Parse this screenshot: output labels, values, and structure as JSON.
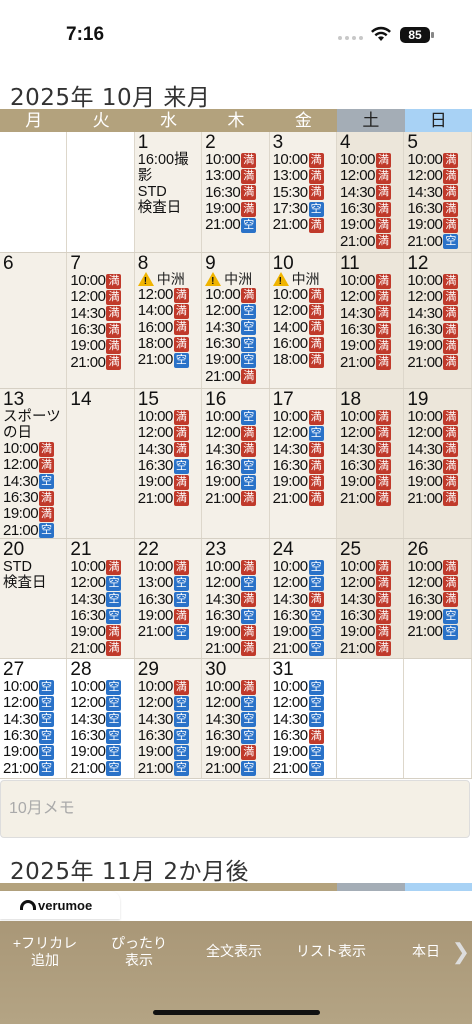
{
  "status": {
    "time": "7:16",
    "battery": "85"
  },
  "month1": {
    "title": "2025年 10月 来月"
  },
  "month2": {
    "title": "2025年 11月 2か月後"
  },
  "weekdays": [
    "月",
    "火",
    "水",
    "木",
    "金",
    "土",
    "日"
  ],
  "badges": {
    "full": "満",
    "open": "空"
  },
  "memo": {
    "placeholder": "10月メモ"
  },
  "ad": {
    "brand": "verumoe"
  },
  "toolbar": {
    "add_label": "+フリカレ\n追加",
    "fit_label": "ぴったり\n表示",
    "fulltext_label": "全文表示",
    "list_label": "リスト表示",
    "today_label": "本日",
    "more_arrow": "❯"
  },
  "weeks": [
    [
      {
        "empty": true
      },
      {
        "empty": true
      },
      {
        "day": "1",
        "note": "16:00撮影\nSTD\n検査日",
        "slots": []
      },
      {
        "day": "2",
        "slots": [
          [
            "10:00",
            "満"
          ],
          [
            "13:00",
            "満"
          ],
          [
            "16:30",
            "満"
          ],
          [
            "19:00",
            "満"
          ],
          [
            "21:00",
            "空"
          ]
        ]
      },
      {
        "day": "3",
        "slots": [
          [
            "10:00",
            "満"
          ],
          [
            "13:00",
            "満"
          ],
          [
            "15:30",
            "満"
          ],
          [
            "17:30",
            "空"
          ],
          [
            "21:00",
            "満"
          ]
        ]
      },
      {
        "day": "4",
        "weekend": true,
        "slots": [
          [
            "10:00",
            "満"
          ],
          [
            "12:00",
            "満"
          ],
          [
            "14:30",
            "満"
          ],
          [
            "16:30",
            "満"
          ],
          [
            "19:00",
            "満"
          ],
          [
            "21:00",
            "満"
          ]
        ]
      },
      {
        "day": "5",
        "weekend": true,
        "slots": [
          [
            "10:00",
            "満"
          ],
          [
            "12:00",
            "満"
          ],
          [
            "14:30",
            "満"
          ],
          [
            "16:30",
            "満"
          ],
          [
            "19:00",
            "満"
          ],
          [
            "21:00",
            "空"
          ]
        ]
      }
    ],
    [
      {
        "day": "6",
        "muted": true,
        "slots": []
      },
      {
        "day": "7",
        "slots": [
          [
            "10:00",
            "満"
          ],
          [
            "12:00",
            "満"
          ],
          [
            "14:30",
            "満"
          ],
          [
            "16:30",
            "満"
          ],
          [
            "19:00",
            "満"
          ],
          [
            "21:00",
            "満"
          ]
        ]
      },
      {
        "day": "8",
        "warn": "中洲",
        "slots": [
          [
            "12:00",
            "満"
          ],
          [
            "14:00",
            "満"
          ],
          [
            "16:00",
            "満"
          ],
          [
            "18:00",
            "満"
          ],
          [
            "21:00",
            "空"
          ]
        ]
      },
      {
        "day": "9",
        "warn": "中洲",
        "slots": [
          [
            "10:00",
            "満"
          ],
          [
            "12:00",
            "空"
          ],
          [
            "14:30",
            "空"
          ],
          [
            "16:30",
            "空"
          ],
          [
            "19:00",
            "空"
          ],
          [
            "21:00",
            "満"
          ]
        ]
      },
      {
        "day": "10",
        "warn": "中洲",
        "slots": [
          [
            "10:00",
            "満"
          ],
          [
            "12:00",
            "満"
          ],
          [
            "14:00",
            "満"
          ],
          [
            "16:00",
            "満"
          ],
          [
            "18:00",
            "満"
          ]
        ]
      },
      {
        "day": "11",
        "weekend": true,
        "slots": [
          [
            "10:00",
            "満"
          ],
          [
            "12:00",
            "満"
          ],
          [
            "14:30",
            "満"
          ],
          [
            "16:30",
            "満"
          ],
          [
            "19:00",
            "満"
          ],
          [
            "21:00",
            "満"
          ]
        ]
      },
      {
        "day": "12",
        "weekend": true,
        "slots": [
          [
            "10:00",
            "満"
          ],
          [
            "12:00",
            "満"
          ],
          [
            "14:30",
            "満"
          ],
          [
            "16:30",
            "満"
          ],
          [
            "19:00",
            "満"
          ],
          [
            "21:00",
            "満"
          ]
        ]
      }
    ],
    [
      {
        "day": "13",
        "note": "スポーツ\nの日",
        "slots": [
          [
            "10:00",
            "満"
          ],
          [
            "12:00",
            "満"
          ],
          [
            "14:30",
            "空"
          ],
          [
            "16:30",
            "満"
          ],
          [
            "19:00",
            "満"
          ],
          [
            "21:00",
            "空"
          ]
        ]
      },
      {
        "day": "14",
        "muted": true,
        "slots": []
      },
      {
        "day": "15",
        "slots": [
          [
            "10:00",
            "満"
          ],
          [
            "12:00",
            "満"
          ],
          [
            "14:30",
            "満"
          ],
          [
            "16:30",
            "空"
          ],
          [
            "19:00",
            "満"
          ],
          [
            "21:00",
            "満"
          ]
        ]
      },
      {
        "day": "16",
        "slots": [
          [
            "10:00",
            "空"
          ],
          [
            "12:00",
            "満"
          ],
          [
            "14:30",
            "満"
          ],
          [
            "16:30",
            "空"
          ],
          [
            "19:00",
            "空"
          ],
          [
            "21:00",
            "満"
          ]
        ]
      },
      {
        "day": "17",
        "slots": [
          [
            "10:00",
            "満"
          ],
          [
            "12:00",
            "空"
          ],
          [
            "14:30",
            "満"
          ],
          [
            "16:30",
            "満"
          ],
          [
            "19:00",
            "満"
          ],
          [
            "21:00",
            "満"
          ]
        ]
      },
      {
        "day": "18",
        "weekend": true,
        "slots": [
          [
            "10:00",
            "満"
          ],
          [
            "12:00",
            "満"
          ],
          [
            "14:30",
            "満"
          ],
          [
            "16:30",
            "満"
          ],
          [
            "19:00",
            "満"
          ],
          [
            "21:00",
            "満"
          ]
        ]
      },
      {
        "day": "19",
        "weekend": true,
        "slots": [
          [
            "10:00",
            "満"
          ],
          [
            "12:00",
            "満"
          ],
          [
            "14:30",
            "満"
          ],
          [
            "16:30",
            "満"
          ],
          [
            "19:00",
            "満"
          ],
          [
            "21:00",
            "満"
          ]
        ]
      }
    ],
    [
      {
        "day": "20",
        "note": "STD\n検査日",
        "slots": []
      },
      {
        "day": "21",
        "slots": [
          [
            "10:00",
            "満"
          ],
          [
            "12:00",
            "空"
          ],
          [
            "14:30",
            "空"
          ],
          [
            "16:30",
            "空"
          ],
          [
            "19:00",
            "満"
          ],
          [
            "21:00",
            "満"
          ]
        ]
      },
      {
        "day": "22",
        "slots": [
          [
            "10:00",
            "満"
          ],
          [
            "13:00",
            "空"
          ],
          [
            "16:30",
            "空"
          ],
          [
            "19:00",
            "満"
          ],
          [
            "21:00",
            "空"
          ]
        ]
      },
      {
        "day": "23",
        "slots": [
          [
            "10:00",
            "満"
          ],
          [
            "12:00",
            "空"
          ],
          [
            "14:30",
            "満"
          ],
          [
            "16:30",
            "空"
          ],
          [
            "19:00",
            "満"
          ],
          [
            "21:00",
            "満"
          ]
        ]
      },
      {
        "day": "24",
        "slots": [
          [
            "10:00",
            "空"
          ],
          [
            "12:00",
            "空"
          ],
          [
            "14:30",
            "満"
          ],
          [
            "16:30",
            "空"
          ],
          [
            "19:00",
            "空"
          ],
          [
            "21:00",
            "空"
          ]
        ]
      },
      {
        "day": "25",
        "weekend": true,
        "slots": [
          [
            "10:00",
            "満"
          ],
          [
            "12:00",
            "満"
          ],
          [
            "14:30",
            "満"
          ],
          [
            "16:30",
            "満"
          ],
          [
            "19:00",
            "満"
          ],
          [
            "21:00",
            "満"
          ]
        ]
      },
      {
        "day": "26",
        "weekend": true,
        "slots": [
          [
            "10:00",
            "満"
          ],
          [
            "12:00",
            "満"
          ],
          [
            "16:30",
            "満"
          ],
          [
            "19:00",
            "空"
          ],
          [
            "21:00",
            "空"
          ]
        ]
      }
    ],
    [
      {
        "day": "27",
        "plain": true,
        "slots": [
          [
            "10:00",
            "空"
          ],
          [
            "12:00",
            "空"
          ],
          [
            "14:30",
            "空"
          ],
          [
            "16:30",
            "空"
          ],
          [
            "19:00",
            "空"
          ],
          [
            "21:00",
            "空"
          ]
        ]
      },
      {
        "day": "28",
        "plain": true,
        "slots": [
          [
            "10:00",
            "空"
          ],
          [
            "12:00",
            "空"
          ],
          [
            "14:30",
            "空"
          ],
          [
            "16:30",
            "空"
          ],
          [
            "19:00",
            "空"
          ],
          [
            "21:00",
            "空"
          ]
        ]
      },
      {
        "day": "29",
        "slots": [
          [
            "10:00",
            "満"
          ],
          [
            "12:00",
            "空"
          ],
          [
            "14:30",
            "空"
          ],
          [
            "16:30",
            "空"
          ],
          [
            "19:00",
            "空"
          ],
          [
            "21:00",
            "空"
          ]
        ]
      },
      {
        "day": "30",
        "slots": [
          [
            "10:00",
            "満"
          ],
          [
            "12:00",
            "空"
          ],
          [
            "14:30",
            "空"
          ],
          [
            "16:30",
            "空"
          ],
          [
            "19:00",
            "満"
          ],
          [
            "21:00",
            "空"
          ]
        ]
      },
      {
        "day": "31",
        "plain": true,
        "slots": [
          [
            "10:00",
            "空"
          ],
          [
            "12:00",
            "空"
          ],
          [
            "14:30",
            "空"
          ],
          [
            "16:30",
            "満"
          ],
          [
            "19:00",
            "空"
          ],
          [
            "21:00",
            "空"
          ]
        ]
      },
      {
        "empty": true
      },
      {
        "empty": true
      }
    ]
  ]
}
